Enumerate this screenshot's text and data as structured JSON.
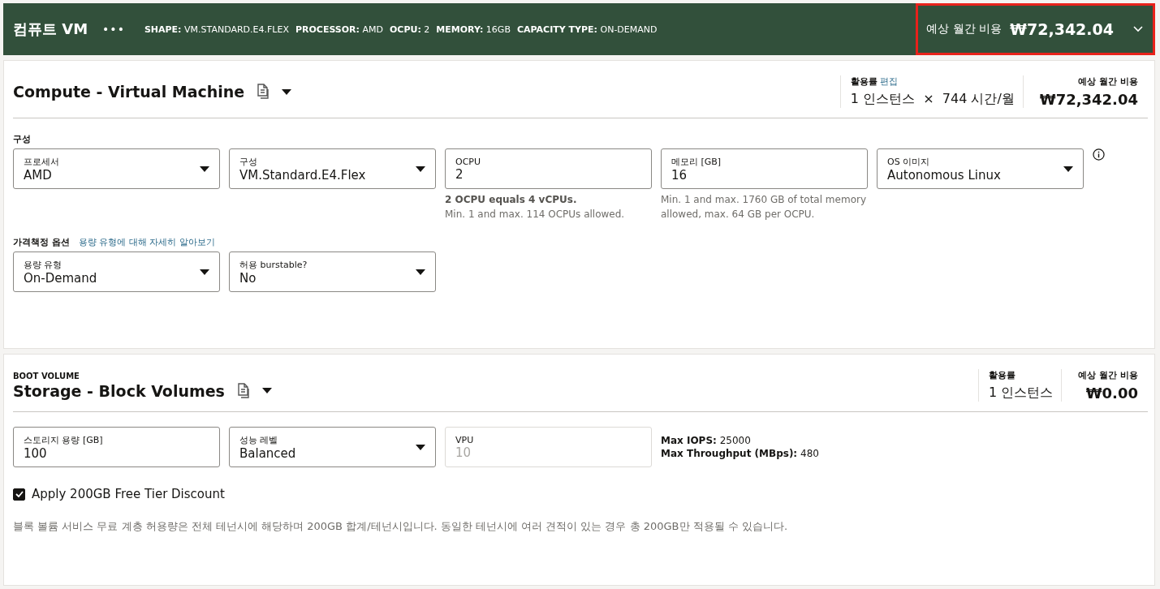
{
  "header": {
    "title": "컴퓨트 VM",
    "menu": "•••",
    "specs": [
      {
        "label": "SHAPE:",
        "value": "VM.STANDARD.E4.FLEX"
      },
      {
        "label": "PROCESSOR:",
        "value": "AMD"
      },
      {
        "label": "OCPU:",
        "value": "2"
      },
      {
        "label": "MEMORY:",
        "value": "16GB"
      },
      {
        "label": "CAPACITY TYPE:",
        "value": "ON-DEMAND"
      }
    ],
    "cost_label": "예상 월간 비용",
    "cost": "₩72,342.04",
    "highlighted": true,
    "expanded": false
  },
  "sections": [
    {
      "title": "Compute - Virtual Machine",
      "usage_label": "활용률",
      "usage_link": "편집",
      "usage": "1 인스턴스  ×  744 시간/월",
      "cost_label": "예상 월간 비용",
      "cost": "₩72,342.04",
      "groups": [
        {
          "label": "구성",
          "fields": [
            {
              "kind": "select",
              "label": "프로세서",
              "value": "AMD",
              "disabled": false
            },
            {
              "kind": "select",
              "label": "구성",
              "value": "VM.Standard.E4.Flex",
              "disabled": false
            },
            {
              "kind": "input",
              "label": "OCPU",
              "value": "2",
              "disabled": false,
              "hint_bold": "2 OCPU equals 4 vCPUs.",
              "hint": "Min. 1 and max. 114 OCPUs allowed."
            },
            {
              "kind": "input",
              "label": "메모리 [GB]",
              "value": "16",
              "disabled": false,
              "hint": "Min. 1 and max. 1760 GB of total memory allowed, max. 64 GB per OCPU."
            },
            {
              "kind": "select",
              "label": "OS 이미지",
              "value": "Autonomous Linux",
              "disabled": false
            }
          ],
          "info": true
        },
        {
          "label": "가격책정 옵션",
          "link": "용량 유형에 대해 자세히 알아보기",
          "fields": [
            {
              "kind": "select",
              "label": "용량 유형",
              "value": "On-Demand",
              "disabled": false
            },
            {
              "kind": "select",
              "label": "허용 burstable?",
              "value": "No",
              "disabled": false
            }
          ]
        }
      ]
    },
    {
      "eyebrow": "BOOT VOLUME",
      "title": "Storage - Block Volumes",
      "usage_label": "활용률",
      "usage": "1 인스턴스",
      "cost_label": "예상 월간 비용",
      "cost": "₩0.00",
      "groups": [
        {
          "fields": [
            {
              "kind": "input",
              "label": "스토리지 용량 [GB]",
              "value": "100",
              "disabled": false
            },
            {
              "kind": "select",
              "label": "성능 레벨",
              "value": "Balanced",
              "disabled": false
            },
            {
              "kind": "input",
              "label": "VPU",
              "value": "10",
              "disabled": true
            }
          ],
          "stats": [
            {
              "label": "Max IOPS:",
              "value": "25000"
            },
            {
              "label": "Max Throughput (MBps):",
              "value": "480"
            }
          ]
        }
      ],
      "checkbox": {
        "label": "Apply 200GB Free Tier Discount",
        "checked": true
      },
      "note": "블록 볼륨 서비스 무료 계층 허용량은 전체 테넌시에 해당하며 200GB 합계/테넌시입니다. 동일한 테넌시에 여러 견적이 있는 경우 총 200GB만 적용될 수 있습니다."
    }
  ]
}
